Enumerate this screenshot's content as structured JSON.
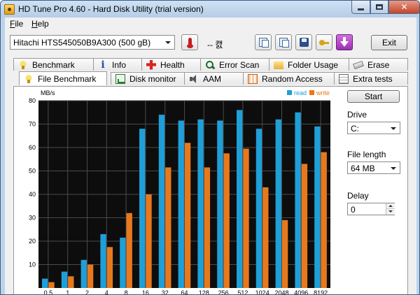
{
  "window": {
    "title": "HD Tune Pro 4.60 - Hard Disk Utility (trial version)",
    "close_glyph": "✕"
  },
  "menu": [
    {
      "label": "File"
    },
    {
      "label": "Help"
    }
  ],
  "toolbar": {
    "drive": "Hitachi HTS545050B9A300  (500 gB)",
    "temperature": "-- 캜",
    "exit_label": "Exit"
  },
  "tabs_back": [
    {
      "label": "Benchmark",
      "icon": "benchmark-icon"
    },
    {
      "label": "Info",
      "icon": "info-icon",
      "glyph": "i"
    },
    {
      "label": "Health",
      "icon": "health-icon"
    },
    {
      "label": "Error Scan",
      "icon": "error-scan-icon"
    },
    {
      "label": "Folder Usage",
      "icon": "folder-icon"
    },
    {
      "label": "Erase",
      "icon": "erase-icon"
    }
  ],
  "tabs_front": [
    {
      "label": "File Benchmark",
      "icon": "file-benchmark-icon",
      "active": true
    },
    {
      "label": "Disk monitor",
      "icon": "disk-monitor-icon"
    },
    {
      "label": "AAM",
      "icon": "speaker-icon"
    },
    {
      "label": "Random Access",
      "icon": "random-access-icon"
    },
    {
      "label": "Extra tests",
      "icon": "extra-tests-icon"
    }
  ],
  "side": {
    "start_label": "Start",
    "drive_label": "Drive",
    "drive_value": "C:",
    "file_length_label": "File length",
    "file_length_value": "64 MB",
    "delay_label": "Delay",
    "delay_value": "0"
  },
  "colors": {
    "read": "#1f9fd8",
    "write": "#e8781c",
    "plot_bg": "#0d0d0d",
    "grid": "#4a4a4a"
  },
  "chart_data": {
    "type": "bar",
    "ylabel": "MB/s",
    "ylim": [
      0,
      80
    ],
    "yticks": [
      10,
      20,
      30,
      40,
      50,
      60,
      70,
      80
    ],
    "categories": [
      "0.5",
      "1",
      "2",
      "4",
      "8",
      "16",
      "32",
      "64",
      "128",
      "256",
      "512",
      "1024",
      "2048",
      "4096",
      "8192"
    ],
    "legend_position": "top-right",
    "grid": true,
    "series": [
      {
        "name": "read",
        "values": [
          4,
          7,
          12,
          23,
          21.5,
          68,
          74,
          71.5,
          72,
          71.5,
          76,
          68,
          72,
          75,
          69
        ]
      },
      {
        "name": "write",
        "values": [
          2.5,
          5,
          10,
          17.5,
          32,
          40,
          51.5,
          62,
          51.5,
          57.5,
          59.5,
          43,
          29,
          53,
          58
        ]
      }
    ]
  }
}
